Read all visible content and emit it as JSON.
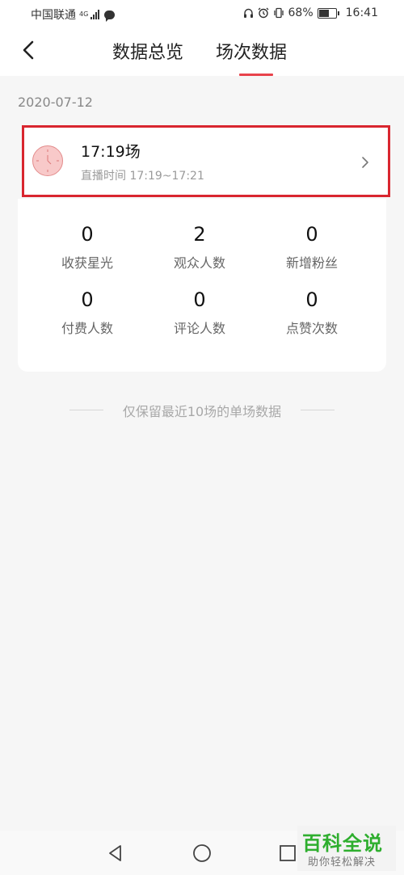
{
  "status_bar": {
    "carrier": "中国联通",
    "network_type": "4G",
    "battery": "68%",
    "battery_level": 0.68,
    "time": "16:41",
    "icons": [
      "headphone-icon",
      "alarm-icon",
      "vibrate-icon",
      "battery-icon",
      "message-icon"
    ]
  },
  "nav": {
    "back_icon": "back-arrow-icon",
    "tabs": [
      {
        "label": "数据总览",
        "active": false
      },
      {
        "label": "场次数据",
        "active": true
      }
    ],
    "accent_color": "#e8424b"
  },
  "date": "2020-07-12",
  "session": {
    "title": "17:19场",
    "time_label": "直播时间",
    "time_range": "17:19~17:21",
    "highlight_color": "#d9262f"
  },
  "stats": [
    {
      "value": "0",
      "label": "收获星光"
    },
    {
      "value": "2",
      "label": "观众人数"
    },
    {
      "value": "0",
      "label": "新增粉丝"
    },
    {
      "value": "0",
      "label": "付费人数"
    },
    {
      "value": "0",
      "label": "评论人数"
    },
    {
      "value": "0",
      "label": "点赞次数"
    }
  ],
  "footnote": "仅保留最近10场的单场数据",
  "watermark": {
    "title": "百科全说",
    "subtitle": "助你轻松解决"
  }
}
